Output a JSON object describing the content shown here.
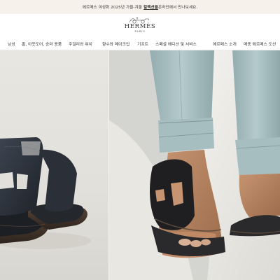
{
  "announcement": {
    "text": "에르메스 여성화 2025년 가을-겨울 컬렉션을 온라인에서 만나보세요.",
    "text_pre": "에르메스 여성화 2025년 가을-겨울",
    "text_bold": "컬렉션을",
    "text_post": " 온라인에서 만나보세요."
  },
  "brand": {
    "name": "HERMÈS",
    "sub": "PARIS"
  },
  "nav": {
    "items": [
      "남성",
      "홈, 아웃도어, 승마 용품",
      "주얼리와 워치",
      "향수와 메이크업",
      "기프트",
      "스페셜 에디션 및 서비스",
      "에르메스 소개",
      "쁘띠 아쉬"
    ],
    "overflow_text": "메종 에르메스 도산"
  },
  "hero": {
    "left_image": "sandal-product-shot",
    "right_image": "sandal-worn-on-feet"
  },
  "colors": {
    "announce_bg": "#f6f1eb",
    "leather": "#2a2c30",
    "trousers": "#a8c0c2",
    "sole": "#4a3a30"
  }
}
